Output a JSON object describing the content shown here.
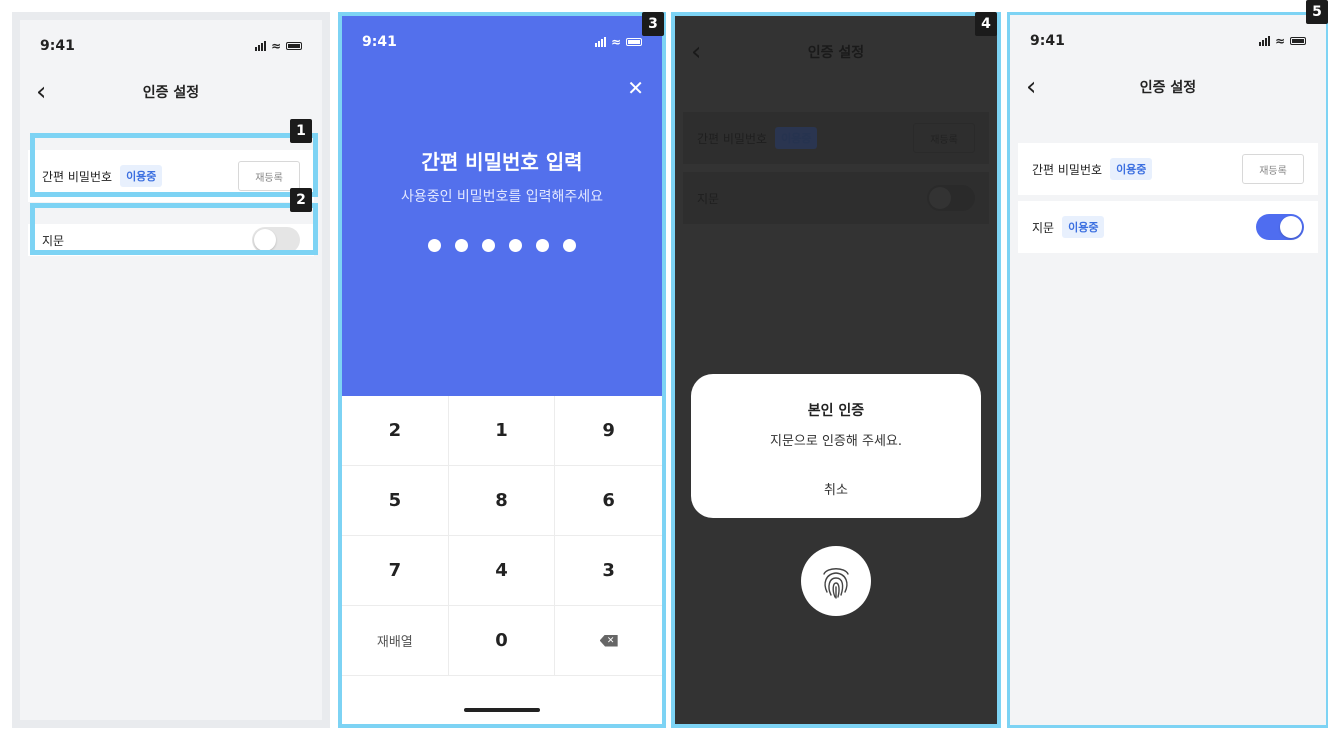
{
  "screen1": {
    "status_time": "9:41",
    "nav_title": "인증 설정",
    "password_row": {
      "label": "간편 비밀번호",
      "badge": "이용중",
      "button": "재등록"
    },
    "fingerprint_row": {
      "label": "지문",
      "toggle_on": false
    },
    "callouts": [
      "1",
      "2"
    ]
  },
  "screen3": {
    "callout": "3",
    "status_time": "9:41",
    "title": "간편 비밀번호 입력",
    "subtitle": "사용중인 비밀번호를 입력해주세요",
    "dots_filled": 6,
    "keys": [
      "2",
      "1",
      "9",
      "5",
      "8",
      "6",
      "7",
      "4",
      "3",
      "재배열",
      "0",
      "⌫"
    ]
  },
  "screen4": {
    "callout": "4",
    "nav_title": "인증 설정",
    "password_row": {
      "label": "간편 비밀번호",
      "badge": "이용중",
      "button": "재등록"
    },
    "fingerprint_row": {
      "label": "지문"
    },
    "modal": {
      "title": "본인 인증",
      "message": "지문으로 인증해 주세요.",
      "cancel": "취소"
    }
  },
  "screen5": {
    "callout": "5",
    "status_time": "9:41",
    "nav_title": "인증 설정",
    "password_row": {
      "label": "간편 비밀번호",
      "badge": "이용중",
      "button": "재등록"
    },
    "fingerprint_row": {
      "label": "지문",
      "badge": "이용중",
      "toggle_on": true
    }
  },
  "colors": {
    "accent": "#5370ec",
    "highlight": "#7dd3f4",
    "badge_text": "#3b6fe0"
  }
}
